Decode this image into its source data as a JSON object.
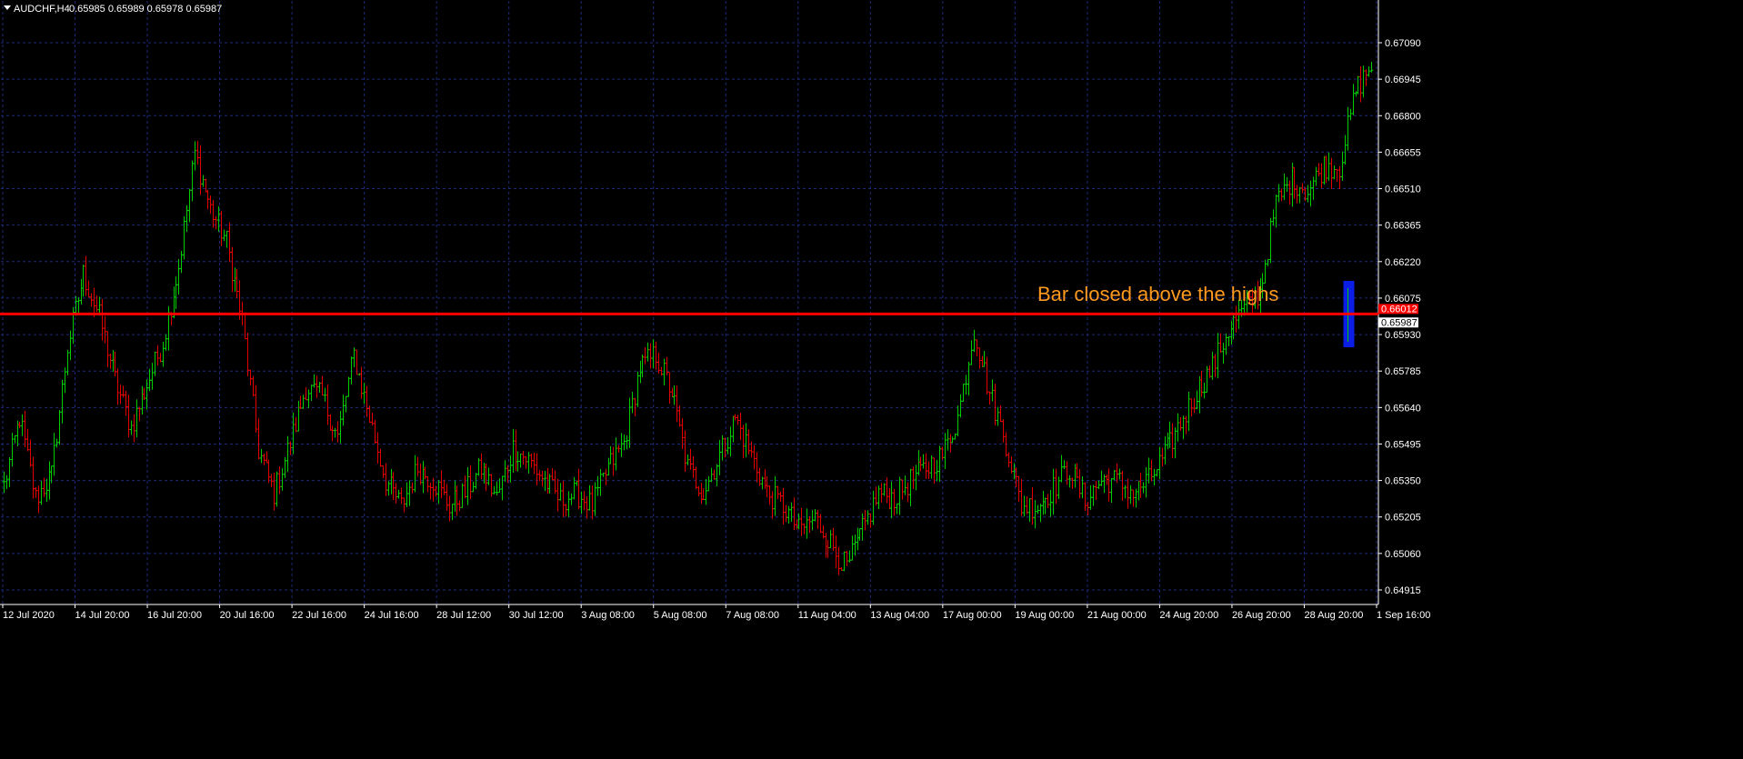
{
  "header": {
    "symbol": "AUDCHF,H4",
    "ohlc": "0.65985 0.65989 0.65978 0.65987"
  },
  "colors": {
    "background": "#000000",
    "up_bar": "#00cc00",
    "down_bar": "#e00000",
    "grid": "#1e2a78",
    "axis": "#ffffff",
    "level_line": "#ff0000",
    "annotation_text": "#ff9a1f",
    "highlight_box": "#0a1ee6"
  },
  "chart_data": {
    "type": "ohlc",
    "symbol": "AUDCHF",
    "timeframe": "H4",
    "y_axis_ticks": [
      "0.67090",
      "0.66945",
      "0.66800",
      "0.66655",
      "0.66510",
      "0.66365",
      "0.66220",
      "0.66075",
      "0.65930",
      "0.65785",
      "0.65640",
      "0.65495",
      "0.65350",
      "0.65205",
      "0.65060",
      "0.64915"
    ],
    "ylim": [
      0.6487,
      0.6717
    ],
    "x_axis_ticks": [
      "12 Jul 2020",
      "14 Jul 20:00",
      "16 Jul 20:00",
      "20 Jul 16:00",
      "22 Jul 16:00",
      "24 Jul 16:00",
      "28 Jul 12:00",
      "30 Jul 12:00",
      "3 Aug 08:00",
      "5 Aug 08:00",
      "7 Aug 08:00",
      "11 Aug 04:00",
      "13 Aug 04:00",
      "17 Aug 00:00",
      "19 Aug 00:00",
      "21 Aug 00:00",
      "24 Aug 20:00",
      "26 Aug 20:00",
      "28 Aug 20:00",
      "1 Sep 16:00"
    ],
    "horizontal_line": {
      "price": 0.66012
    },
    "price_labels": [
      {
        "text": "0.66012",
        "bg": "#ff0000",
        "fg": "#ffffff"
      },
      {
        "text": "0.65987",
        "bg": "#ffffff",
        "fg": "#000000"
      }
    ],
    "annotation": {
      "text": "Bar closed above the highs"
    },
    "highlight_bar_index": 9,
    "closes_anchor": [
      [
        0,
        0.6533
      ],
      [
        6,
        0.656
      ],
      [
        12,
        0.6528
      ],
      [
        18,
        0.6537
      ],
      [
        24,
        0.6588
      ],
      [
        30,
        0.6617
      ],
      [
        36,
        0.66
      ],
      [
        42,
        0.6575
      ],
      [
        48,
        0.6556
      ],
      [
        54,
        0.6573
      ],
      [
        60,
        0.659
      ],
      [
        66,
        0.662
      ],
      [
        72,
        0.6665
      ],
      [
        78,
        0.6643
      ],
      [
        84,
        0.663
      ],
      [
        90,
        0.6598
      ],
      [
        96,
        0.6547
      ],
      [
        102,
        0.653
      ],
      [
        108,
        0.655
      ],
      [
        114,
        0.6572
      ],
      [
        120,
        0.6568
      ],
      [
        126,
        0.6552
      ],
      [
        132,
        0.6585
      ],
      [
        138,
        0.656
      ],
      [
        144,
        0.6535
      ],
      [
        150,
        0.6525
      ],
      [
        156,
        0.654
      ],
      [
        162,
        0.6535
      ],
      [
        168,
        0.6525
      ],
      [
        174,
        0.653
      ],
      [
        180,
        0.654
      ],
      [
        186,
        0.6528
      ],
      [
        192,
        0.6548
      ],
      [
        198,
        0.6543
      ],
      [
        204,
        0.6535
      ],
      [
        210,
        0.6527
      ],
      [
        216,
        0.653
      ],
      [
        222,
        0.6525
      ],
      [
        228,
        0.654
      ],
      [
        234,
        0.655
      ],
      [
        240,
        0.658
      ],
      [
        246,
        0.6585
      ],
      [
        252,
        0.657
      ],
      [
        258,
        0.654
      ],
      [
        264,
        0.653
      ],
      [
        270,
        0.6545
      ],
      [
        276,
        0.656
      ],
      [
        282,
        0.6545
      ],
      [
        288,
        0.653
      ],
      [
        294,
        0.6525
      ],
      [
        300,
        0.6515
      ],
      [
        306,
        0.652
      ],
      [
        312,
        0.651
      ],
      [
        318,
        0.65
      ],
      [
        324,
        0.6515
      ],
      [
        330,
        0.653
      ],
      [
        336,
        0.6528
      ],
      [
        342,
        0.6535
      ],
      [
        348,
        0.654
      ],
      [
        354,
        0.6545
      ],
      [
        360,
        0.656
      ],
      [
        366,
        0.6595
      ],
      [
        372,
        0.657
      ],
      [
        378,
        0.655
      ],
      [
        384,
        0.6525
      ],
      [
        390,
        0.6525
      ],
      [
        396,
        0.6532
      ],
      [
        402,
        0.654
      ],
      [
        408,
        0.6527
      ],
      [
        414,
        0.6535
      ],
      [
        420,
        0.6535
      ],
      [
        426,
        0.653
      ],
      [
        432,
        0.6535
      ],
      [
        438,
        0.6545
      ],
      [
        444,
        0.6558
      ],
      [
        450,
        0.657
      ],
      [
        456,
        0.658
      ],
      [
        462,
        0.6595
      ],
      [
        468,
        0.6603
      ],
      [
        474,
        0.661
      ],
      [
        480,
        0.6645
      ],
      [
        486,
        0.6655
      ],
      [
        492,
        0.665
      ],
      [
        498,
        0.666
      ],
      [
        504,
        0.666
      ],
      [
        510,
        0.669
      ],
      [
        516,
        0.67
      ]
    ],
    "bar_count": 517
  }
}
